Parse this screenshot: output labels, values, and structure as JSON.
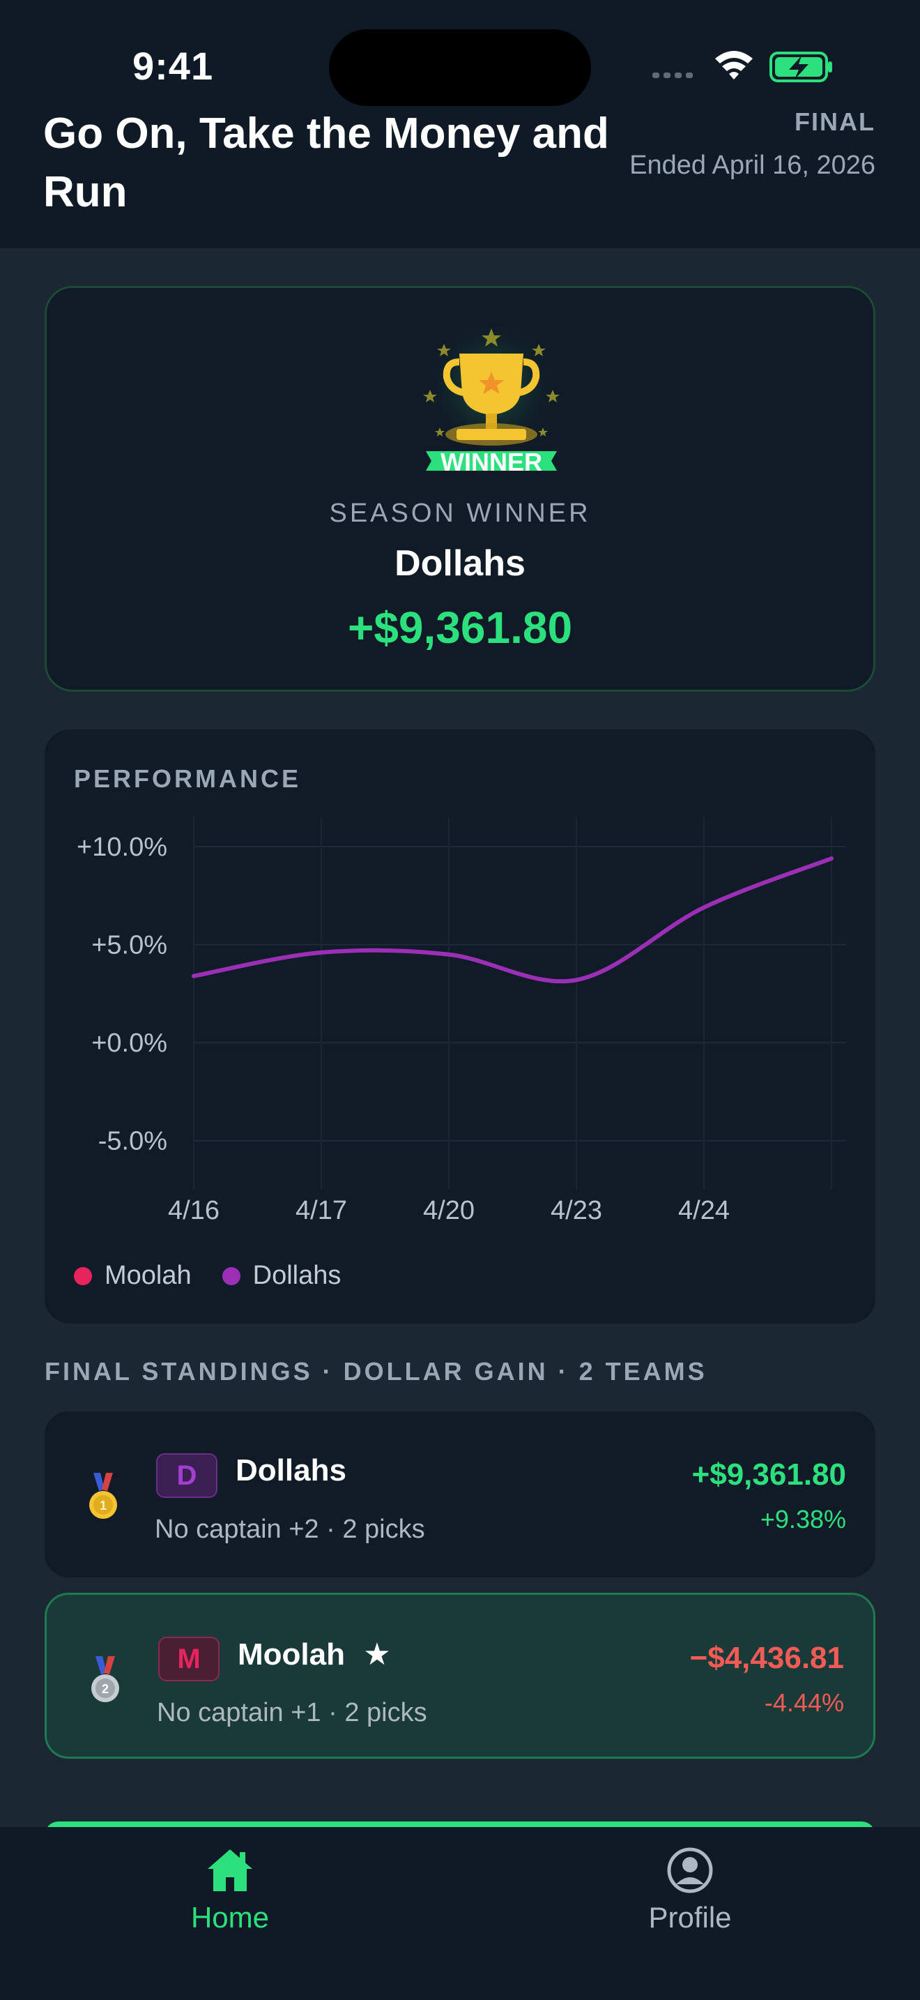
{
  "status_bar": {
    "time": "9:41"
  },
  "header": {
    "title": "Go On, Take the Money and Run",
    "status": "FINAL",
    "ended": "Ended April 16, 2026"
  },
  "winner": {
    "badge_text": "WINNER",
    "label": "SEASON WINNER",
    "team": "Dollahs",
    "amount": "+$9,361.80"
  },
  "performance": {
    "title": "PERFORMANCE",
    "legend": [
      {
        "name": "Moolah",
        "color": "#e8245e"
      },
      {
        "name": "Dollahs",
        "color": "#9b2fb5"
      }
    ]
  },
  "chart_data": {
    "type": "line",
    "x": [
      "4/16",
      "4/17",
      "4/20",
      "4/23",
      "4/24",
      ""
    ],
    "x_tick_labels": [
      "4/16",
      "4/17",
      "4/20",
      "4/23",
      "4/24"
    ],
    "y_tick_labels": [
      "+10.0%",
      "+5.0%",
      "+0.0%",
      "-5.0%"
    ],
    "ylim": [
      -7.5,
      11.5
    ],
    "grid": true,
    "legend_position": "bottom-left",
    "series": [
      {
        "name": "Dollahs",
        "color": "#9b2fb5",
        "values": [
          3.4,
          4.6,
          4.5,
          3.2,
          6.9,
          9.4
        ]
      }
    ]
  },
  "standings": {
    "header": "FINAL STANDINGS · DOLLAR GAIN  ·  2 TEAMS",
    "teams": [
      {
        "rank_icon": "medal-1",
        "initial": "D",
        "name": "Dollahs",
        "sub": "No captain +2 · 2 picks",
        "amount": "+$9,361.80",
        "pct": "+9.38%",
        "amount_color": "#2de07e"
      },
      {
        "rank_icon": "medal-2",
        "initial": "M",
        "name": "Moolah",
        "sub": "No captain +1 · 2 picks",
        "amount": "−$4,436.81",
        "pct": "-4.44%",
        "amount_color": "#f25c54"
      }
    ]
  },
  "tabbar": {
    "home": "Home",
    "profile": "Profile"
  }
}
